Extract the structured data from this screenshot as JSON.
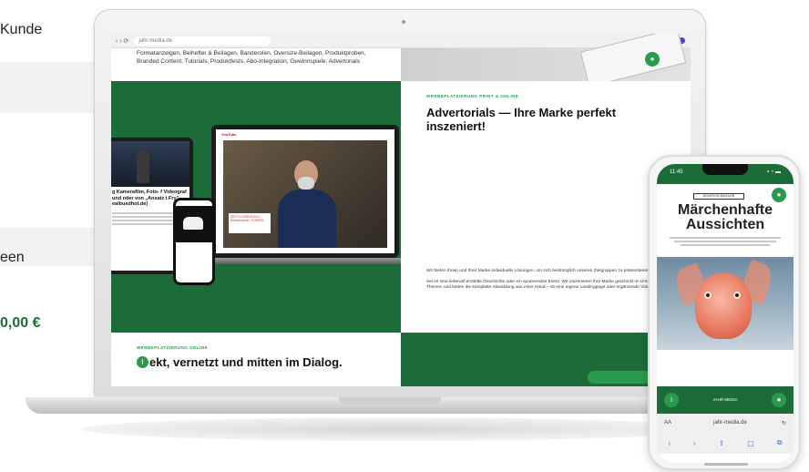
{
  "left_fragment": {
    "kunde": "Kunde",
    "een": "een",
    "price": "0,00 €"
  },
  "browser": {
    "nav_icons": "‹ › ⟳",
    "url": "jahr-media.de"
  },
  "laptop_page": {
    "top_text": "Formatanzeigen, Beihefter & Beilagen, Banderolen, Oversize-Beilagen, Produktproben, Branded Content, Tutorials, Produkttests, Abo-Integration, Gewinnspiele, Advertorials",
    "advertorial_overline": "WERBEPLATZIERUNG PRINT & ONLINE",
    "advertorial_title": "Advertorials — Ihre Marke perfekt inszeniert!",
    "advertorial_body_1": "Wir bieten Ihnen und Ihrer Marke individuelle Lösungen, um sich bestmöglich unseren Zielgruppen zu präsentieren.",
    "advertorial_body_2": "Sei es eine liebevoll erzählte Geschichte oder ein spannendes Event. Wir inszenieren Ihre Marke geschickt im Umfeld interessanter Themen und bieten die komplette Abwicklung aus einer Hand – ob eine eigene Landingpage oder ergänzende Videos.",
    "dialog_overline": "WERBEPLATZIERUNG ONLINE",
    "dialog_title": "ekt, vernetzt und mitten im Dialog.",
    "tablet_headline": "g Kamerafilm, Foto- f Videograf und nder von „Ansatz t Fry\" ealbuedhot.de)",
    "video_overlay": "DER FLOSSENKOCH Rübenwurzeln · EUROPA",
    "yt_label": "YouTube"
  },
  "phone": {
    "time": "11:45",
    "signal": "▪ ◔ ▬",
    "chip": "NOVATION MAGAZIN",
    "headline_1": "Märchenhafte",
    "headline_2": "Aussichten",
    "brand": "JAHR MEDIA",
    "url_aa": "AA",
    "url": "jahr-media.de",
    "reload": "↻",
    "toolbar": [
      "‹",
      "›",
      "⇪",
      "▢",
      "⧉"
    ]
  },
  "colors": {
    "brand_green": "#1e6b3a",
    "accent_green": "#2a9a4e"
  }
}
